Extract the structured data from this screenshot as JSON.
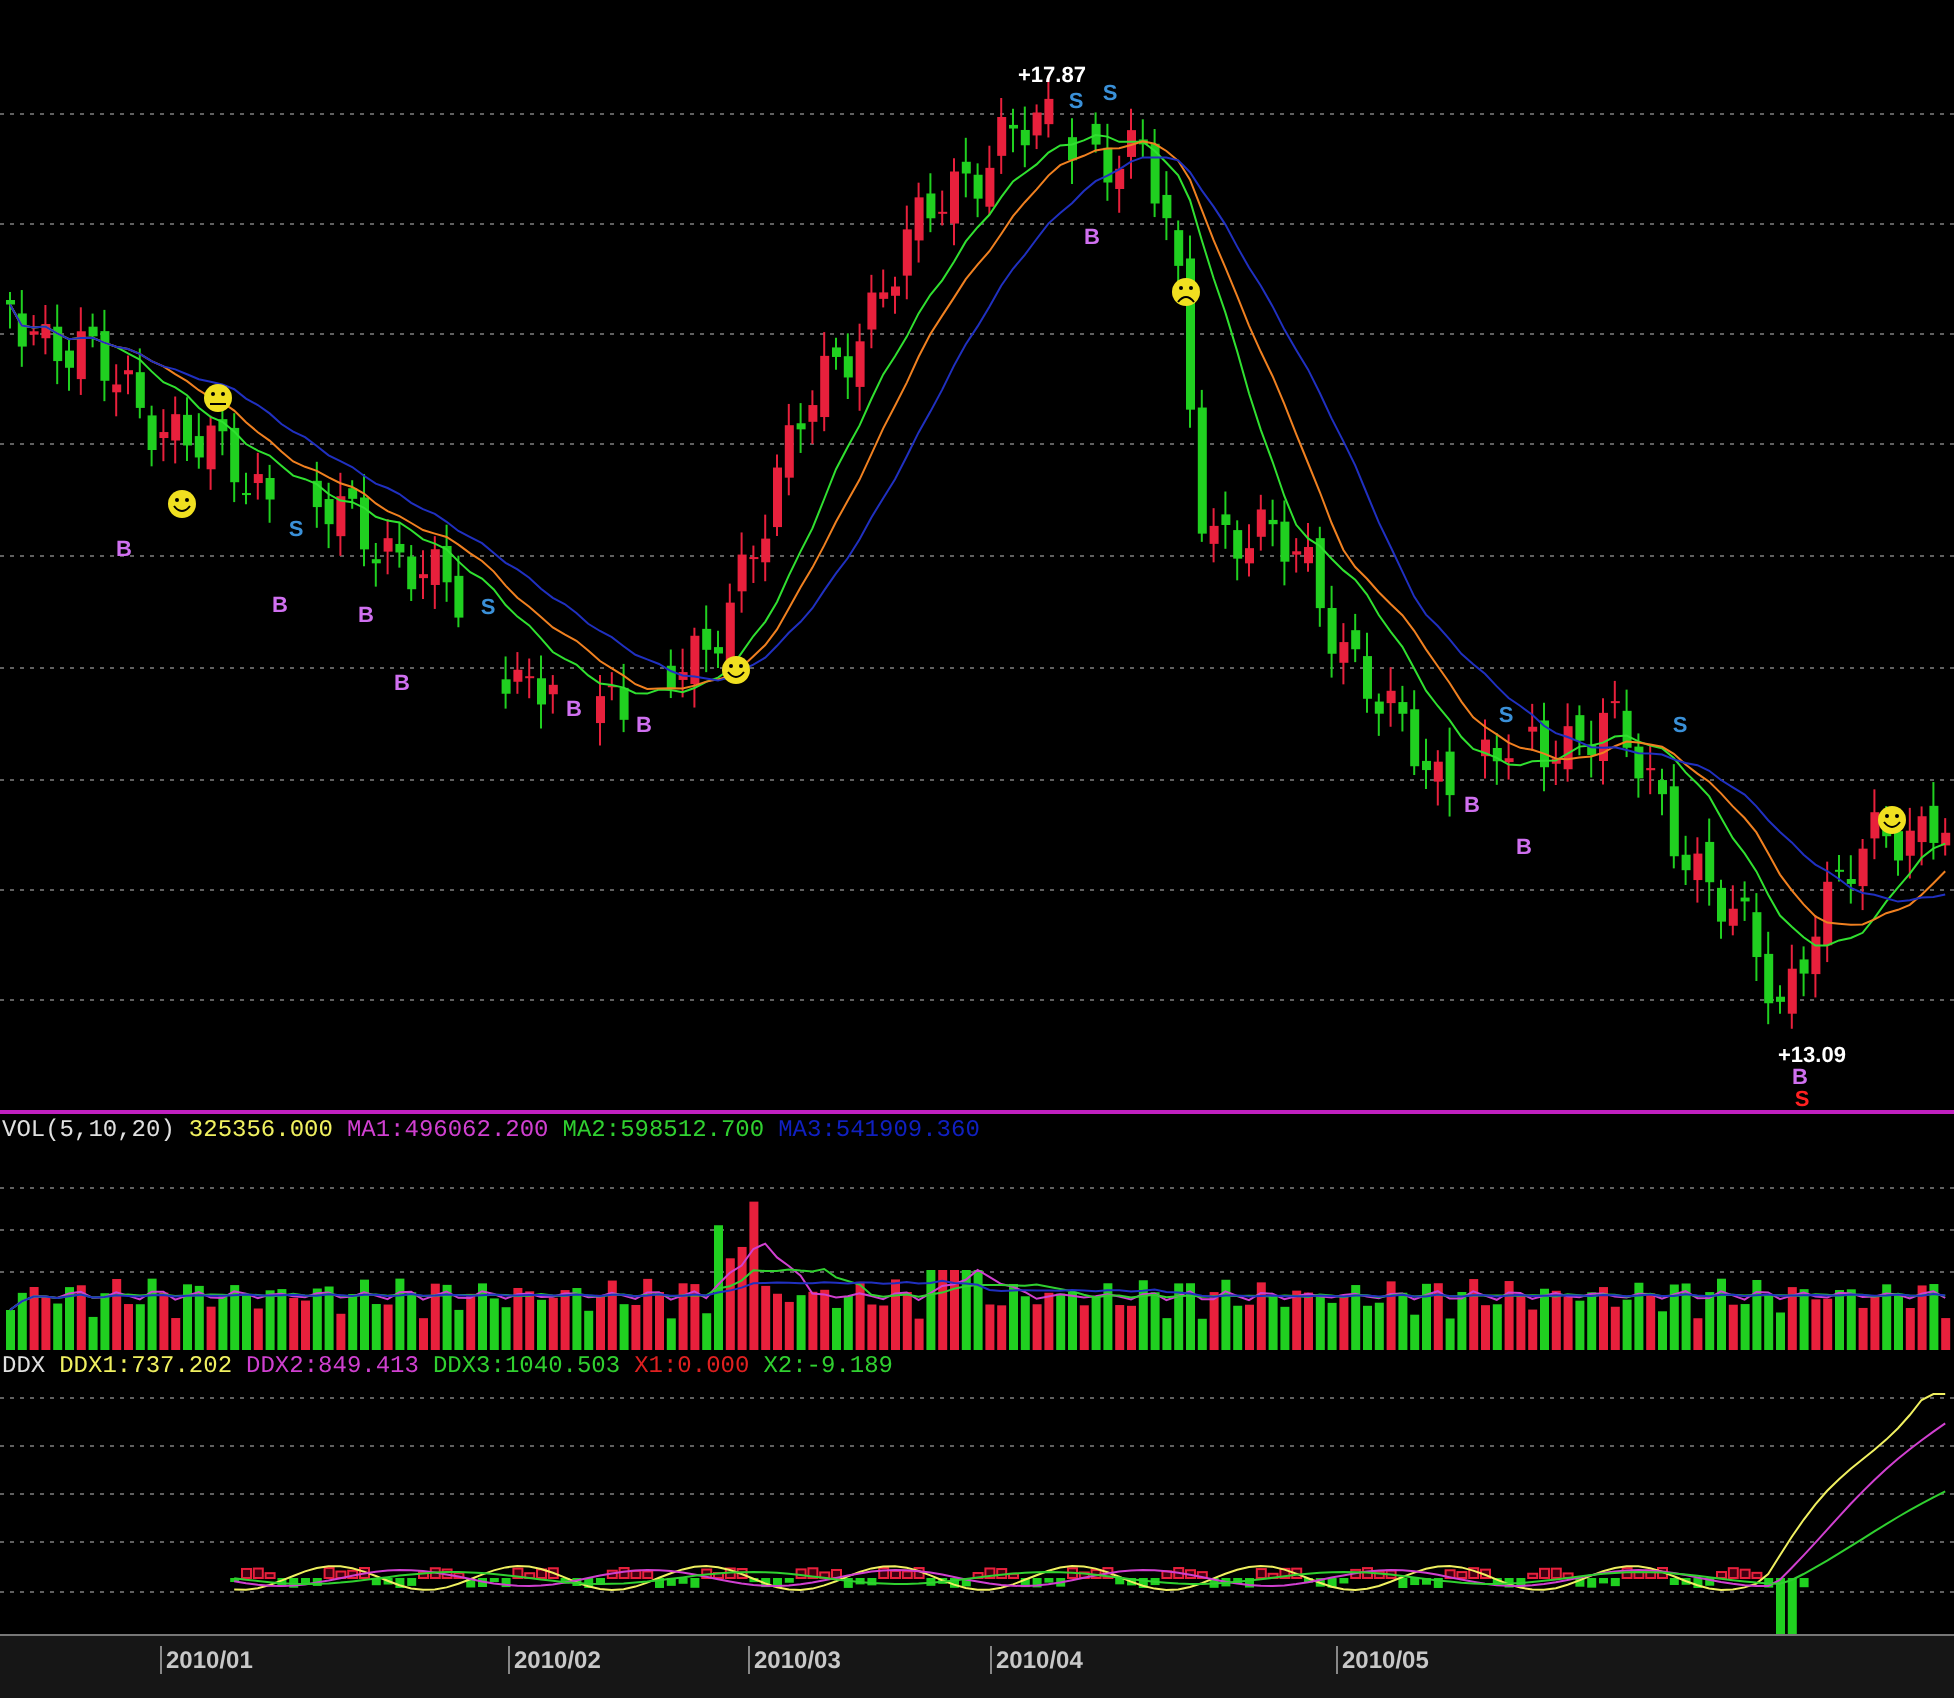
{
  "price_panel": {
    "high_label": "+17.87",
    "low_label": "+13.09",
    "signals": [
      {
        "text": "B",
        "color": "#d070f0"
      },
      {
        "text": "B",
        "color": "#d070f0"
      },
      {
        "text": "S",
        "color": "#3a90d8"
      },
      {
        "text": "B",
        "color": "#d070f0"
      },
      {
        "text": "B",
        "color": "#d070f0"
      },
      {
        "text": "S",
        "color": "#3a90d8"
      },
      {
        "text": "B",
        "color": "#d070f0"
      },
      {
        "text": "B",
        "color": "#d070f0"
      },
      {
        "text": "S",
        "color": "#3a90d8"
      },
      {
        "text": "B",
        "color": "#d070f0"
      },
      {
        "text": "S",
        "color": "#3a90d8"
      },
      {
        "text": "B",
        "color": "#d070f0"
      },
      {
        "text": "S",
        "color": "#3a90d8"
      },
      {
        "text": "B",
        "color": "#d070f0"
      },
      {
        "text": "S",
        "color": "#3a90d8"
      },
      {
        "text": "B",
        "color": "#d070f0"
      },
      {
        "text": "S",
        "color": "#ff2020"
      }
    ]
  },
  "volume_panel": {
    "legend": [
      {
        "text": "VOL(5,10,20)",
        "color": "#e0e0e0"
      },
      {
        "text": "325356.000",
        "color": "#f0f060"
      },
      {
        "text": "MA1:496062.200",
        "color": "#d040d0"
      },
      {
        "text": "MA2:598512.700",
        "color": "#30d030"
      },
      {
        "text": "MA3:541909.360",
        "color": "#1020c0"
      }
    ]
  },
  "ddx_panel": {
    "legend": [
      {
        "text": "DDX",
        "color": "#e0e0e0"
      },
      {
        "text": "DDX1:737.202",
        "color": "#f0f060"
      },
      {
        "text": "DDX2:849.413",
        "color": "#d040d0"
      },
      {
        "text": "DDX3:1040.503",
        "color": "#30d030"
      },
      {
        "text": "X1:0.000",
        "color": "#e02020"
      },
      {
        "text": "X2:-9.189",
        "color": "#30d030"
      }
    ]
  },
  "time_axis": {
    "labels": [
      "2010/01",
      "2010/02",
      "2010/03",
      "2010/04",
      "2010/05"
    ]
  }
}
